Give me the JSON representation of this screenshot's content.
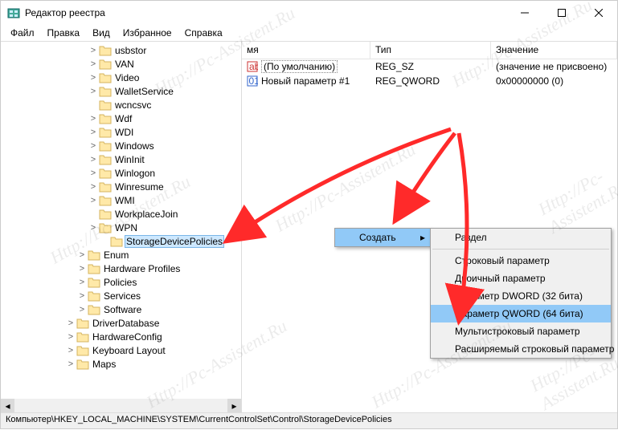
{
  "window": {
    "title": "Редактор реестра"
  },
  "menu": {
    "file": "Файл",
    "edit": "Правка",
    "view": "Вид",
    "favorites": "Избранное",
    "help": "Справка"
  },
  "tree": {
    "items": [
      {
        "indent": 108,
        "exp": ">",
        "label": "usbstor"
      },
      {
        "indent": 108,
        "exp": ">",
        "label": "VAN"
      },
      {
        "indent": 108,
        "exp": ">",
        "label": "Video"
      },
      {
        "indent": 108,
        "exp": ">",
        "label": "WalletService"
      },
      {
        "indent": 108,
        "exp": "",
        "label": "wcncsvc"
      },
      {
        "indent": 108,
        "exp": ">",
        "label": "Wdf"
      },
      {
        "indent": 108,
        "exp": ">",
        "label": "WDI"
      },
      {
        "indent": 108,
        "exp": ">",
        "label": "Windows"
      },
      {
        "indent": 108,
        "exp": ">",
        "label": "WinInit"
      },
      {
        "indent": 108,
        "exp": ">",
        "label": "Winlogon"
      },
      {
        "indent": 108,
        "exp": ">",
        "label": "Winresume"
      },
      {
        "indent": 108,
        "exp": ">",
        "label": "WMI"
      },
      {
        "indent": 108,
        "exp": "",
        "label": "WorkplaceJoin"
      },
      {
        "indent": 108,
        "exp": ">",
        "label": "WPN"
      },
      {
        "indent": 122,
        "exp": "",
        "label": "StorageDevicePolicies",
        "selected": true
      },
      {
        "indent": 94,
        "exp": ">",
        "label": "Enum"
      },
      {
        "indent": 94,
        "exp": ">",
        "label": "Hardware Profiles"
      },
      {
        "indent": 94,
        "exp": ">",
        "label": "Policies"
      },
      {
        "indent": 94,
        "exp": ">",
        "label": "Services"
      },
      {
        "indent": 94,
        "exp": ">",
        "label": "Software"
      },
      {
        "indent": 80,
        "exp": ">",
        "label": "DriverDatabase"
      },
      {
        "indent": 80,
        "exp": ">",
        "label": "HardwareConfig"
      },
      {
        "indent": 80,
        "exp": ">",
        "label": "Keyboard Layout"
      },
      {
        "indent": 80,
        "exp": ">",
        "label": "Maps"
      }
    ]
  },
  "list": {
    "headers": {
      "name": "мя",
      "type": "Тип",
      "value": "Значение"
    },
    "rows": [
      {
        "name": "(По умолчанию)",
        "type": "REG_SZ",
        "value": "(значение не присвоено)",
        "default": true
      },
      {
        "name": "Новый параметр #1",
        "type": "REG_QWORD",
        "value": "0x00000000 (0)",
        "default": false
      }
    ],
    "col_widths": {
      "name": 160,
      "type": 150
    }
  },
  "context": {
    "create": "Создать",
    "sub": {
      "key": "Раздел",
      "string": "Строковый параметр",
      "binary": "Двоичный параметр",
      "dword": "Параметр DWORD (32 бита)",
      "qword": "Параметр QWORD (64 бита)",
      "multi": "Мультистроковый параметр",
      "expand": "Расширяемый строковый параметр"
    }
  },
  "status": {
    "path": "Компьютер\\HKEY_LOCAL_MACHINE\\SYSTEM\\CurrentControlSet\\Control\\StorageDevicePolicies"
  },
  "watermark": "Http://Pc-Assistent.Ru"
}
